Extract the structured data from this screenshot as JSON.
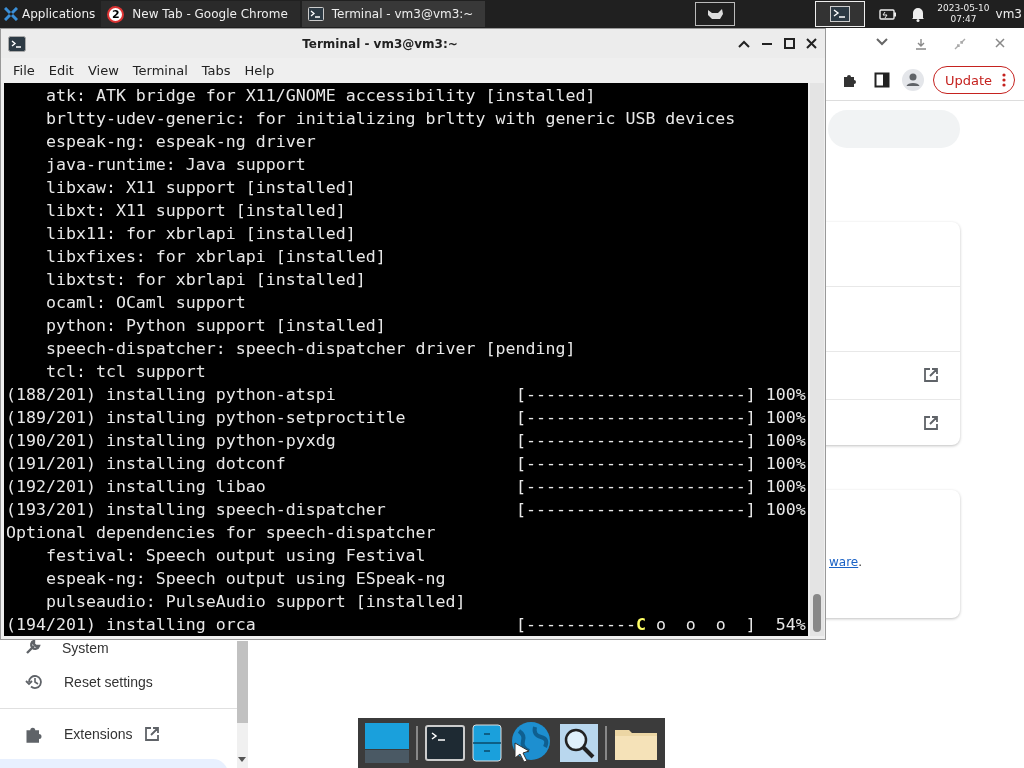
{
  "taskbar": {
    "apps_label": "Applications",
    "tasks": [
      {
        "kind": "chrome",
        "badge": "2",
        "label": "New Tab - Google Chrome",
        "selected": false
      },
      {
        "kind": "terminal",
        "label": "Terminal - vm3@vm3:~",
        "selected": true
      }
    ],
    "clock": {
      "date": "2023-05-10",
      "time": "07:47"
    },
    "user": "vm3"
  },
  "browser": {
    "update_button": "Update",
    "sidebar": [
      {
        "kind": "system",
        "label": "System",
        "external": false
      },
      {
        "kind": "reset",
        "label": "Reset settings",
        "external": false
      },
      {
        "kind": "extensions",
        "label": "Extensions",
        "external": true
      }
    ],
    "link_text": "ware",
    "link_suffix": "."
  },
  "terminal": {
    "title": "Terminal - vm3@vm3:~",
    "menu": [
      "File",
      "Edit",
      "View",
      "Terminal",
      "Tabs",
      "Help"
    ],
    "lines": [
      {
        "kind": "text",
        "text": "    atk: ATK bridge for X11/GNOME accessibility [installed]"
      },
      {
        "kind": "text",
        "text": "    brltty-udev-generic: for initializing brltty with generic USB devices"
      },
      {
        "kind": "text",
        "text": "    espeak-ng: espeak-ng driver"
      },
      {
        "kind": "text",
        "text": "    java-runtime: Java support"
      },
      {
        "kind": "text",
        "text": "    libxaw: X11 support [installed]"
      },
      {
        "kind": "text",
        "text": "    libxt: X11 support [installed]"
      },
      {
        "kind": "text",
        "text": "    libx11: for xbrlapi [installed]"
      },
      {
        "kind": "text",
        "text": "    libxfixes: for xbrlapi [installed]"
      },
      {
        "kind": "text",
        "text": "    libxtst: for xbrlapi [installed]"
      },
      {
        "kind": "text",
        "text": "    ocaml: OCaml support"
      },
      {
        "kind": "text",
        "text": "    python: Python support [installed]"
      },
      {
        "kind": "text",
        "text": "    speech-dispatcher: speech-dispatcher driver [pending]"
      },
      {
        "kind": "text",
        "text": "    tcl: tcl support"
      },
      {
        "kind": "progress",
        "label": "(188/201) installing python-atspi",
        "bar": "[----------------------]",
        "percent": "100%"
      },
      {
        "kind": "progress",
        "label": "(189/201) installing python-setproctitle",
        "bar": "[----------------------]",
        "percent": "100%"
      },
      {
        "kind": "progress",
        "label": "(190/201) installing python-pyxdg",
        "bar": "[----------------------]",
        "percent": "100%"
      },
      {
        "kind": "progress",
        "label": "(191/201) installing dotconf",
        "bar": "[----------------------]",
        "percent": "100%"
      },
      {
        "kind": "progress",
        "label": "(192/201) installing libao",
        "bar": "[----------------------]",
        "percent": "100%"
      },
      {
        "kind": "progress",
        "label": "(193/201) installing speech-dispatcher",
        "bar": "[----------------------]",
        "percent": "100%"
      },
      {
        "kind": "text",
        "text": "Optional dependencies for speech-dispatcher"
      },
      {
        "kind": "text",
        "text": "    festival: Speech output using Festival"
      },
      {
        "kind": "text",
        "text": "    espeak-ng: Speech output using ESpeak-ng"
      },
      {
        "kind": "text",
        "text": "    pulseaudio: PulseAudio support [installed]"
      },
      {
        "kind": "pacman",
        "label": "(194/201) installing orca",
        "bar": "[-----------",
        "pacman": "C",
        "rest": " o  o  o  ]",
        "percent": "54%"
      }
    ]
  }
}
